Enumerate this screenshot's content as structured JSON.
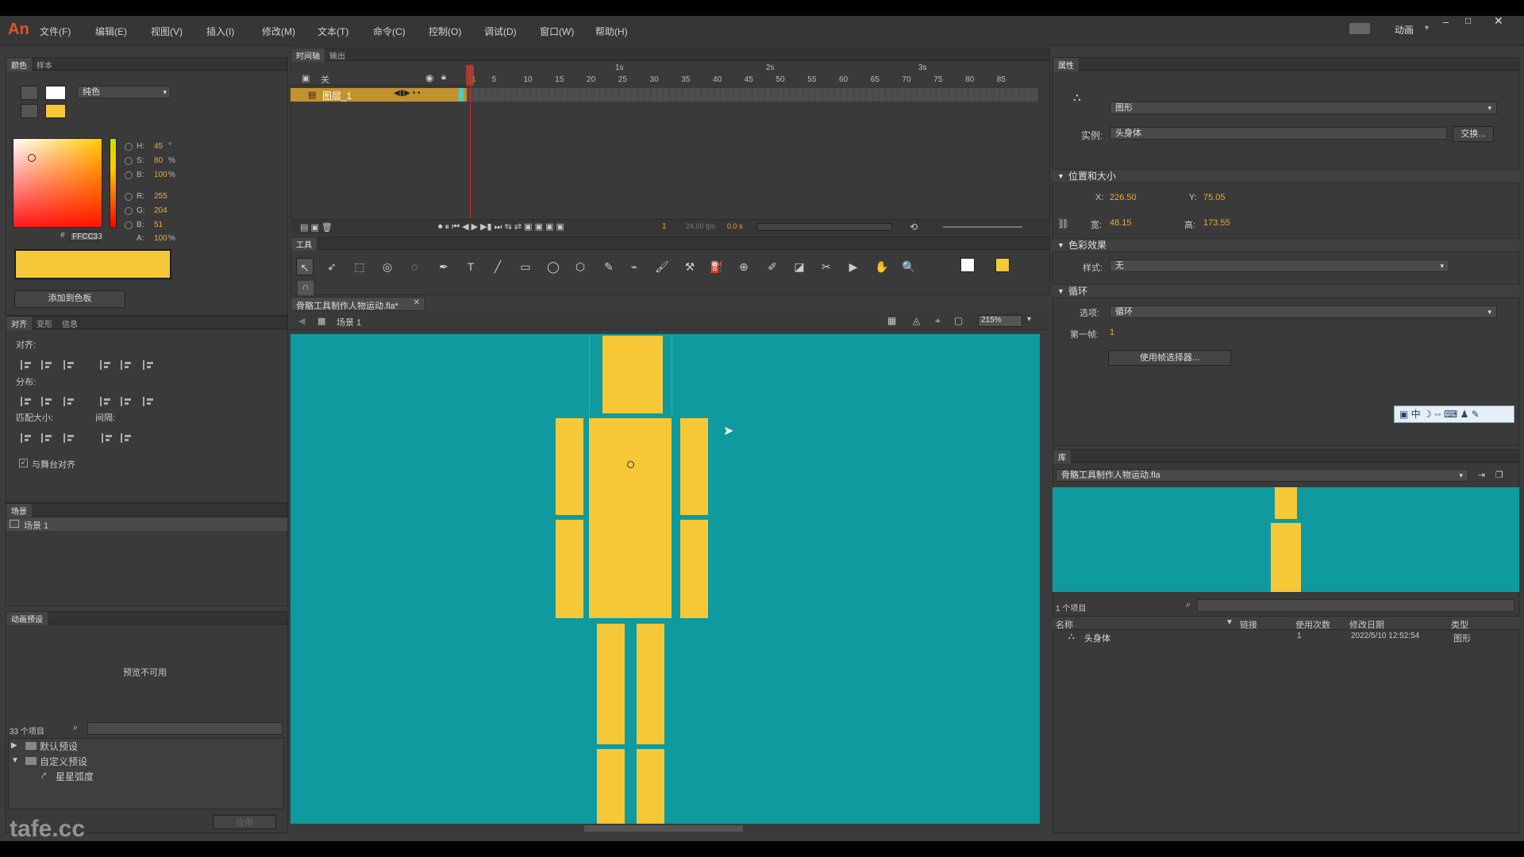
{
  "app": {
    "logo": "An",
    "workspace": "动画"
  },
  "menu": [
    "文件(F)",
    "编辑(E)",
    "视图(V)",
    "插入(I)",
    "修改(M)",
    "文本(T)",
    "命令(C)",
    "控制(O)",
    "调试(D)",
    "窗口(W)",
    "帮助(H)"
  ],
  "color_panel": {
    "tabs": [
      "颜色",
      "样本"
    ],
    "fill_type": "纯色",
    "h_label": "H:",
    "h": "45",
    "h_unit": "°",
    "s_label": "S:",
    "s": "80",
    "s_unit": "%",
    "b_label": "B:",
    "b": "100",
    "b_unit": "%",
    "r_label": "R:",
    "r": "255",
    "g_label": "G:",
    "g": "204",
    "bl_label": "B:",
    "bl": "51",
    "a_label": "A:",
    "a": "100",
    "a_unit": "%",
    "hex_label": "#",
    "hex": "FFCC33",
    "add_swatch": "添加到色板",
    "swatch_color": "#FFCC33"
  },
  "align_panel": {
    "tabs": [
      "对齐",
      "变形",
      "信息"
    ],
    "align": "对齐:",
    "distribute": "分布:",
    "match_size": "匹配大小:",
    "spacing": "间隔:",
    "align_to_stage": "与舞台对齐"
  },
  "scene_panel": {
    "title": "场景",
    "item": "场景 1"
  },
  "motion_presets": {
    "title": "动画预设",
    "preview": "预览不可用",
    "count": "33 个项目",
    "folders": [
      "默认预设",
      "自定义预设"
    ],
    "item": "星星弧度",
    "apply": "应用"
  },
  "timeline": {
    "tabs": [
      "时间轴",
      "输出"
    ],
    "layer_header": "关",
    "layer": "图层_1",
    "markers": [
      "1s",
      "2s",
      "3s"
    ],
    "frames": [
      "1",
      "5",
      "10",
      "15",
      "20",
      "25",
      "30",
      "35",
      "40",
      "45",
      "50",
      "55",
      "60",
      "65",
      "70",
      "75",
      "80",
      "85"
    ],
    "frame_num": "1",
    "fps": "24.00 fps",
    "time": "0.0 s"
  },
  "tools_panel": {
    "title": "工具"
  },
  "doc": {
    "tab": "骨骼工具制作人物运动.fla*",
    "scene": "场景 1",
    "zoom": "215%",
    "stage_color": "#0e9a9f",
    "figure_color": "#f6c838"
  },
  "properties": {
    "title": "属性",
    "type": "图形",
    "instance_label": "实例:",
    "instance": "头身体",
    "swap": "交换...",
    "pos_size": "位置和大小",
    "x_label": "X:",
    "x": "226.50",
    "y_label": "Y:",
    "y": "75.05",
    "w_label": "宽:",
    "w": "48.15",
    "h_label": "高:",
    "h": "173.55",
    "color_effect": "色彩效果",
    "style_label": "样式:",
    "style": "无",
    "loop": "循环",
    "option_label": "选项:",
    "option": "循环",
    "first_frame_label": "第一帧:",
    "first_frame": "1",
    "frame_picker": "使用帧选择器..."
  },
  "ime": {
    "label": "中"
  },
  "library": {
    "title": "库",
    "file": "骨骼工具制作人物运动.fla",
    "count": "1 个项目",
    "cols": [
      "名称",
      "链接",
      "使用次数",
      "修改日期",
      "类型"
    ],
    "rows": [
      {
        "name": "头身体",
        "link": "",
        "uses": "1",
        "date": "2022/5/10 12:52:54",
        "type": "图形"
      }
    ]
  },
  "watermark": "tafe.cc"
}
